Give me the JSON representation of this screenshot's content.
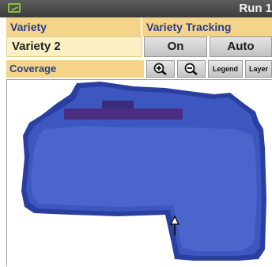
{
  "titlebar": {
    "title": "Run 1",
    "icon": "tractor-monitor-icon"
  },
  "variety": {
    "label": "Variety",
    "value": "Variety 2"
  },
  "tracking": {
    "label": "Variety Tracking",
    "on_label": "On",
    "auto_label": "Auto"
  },
  "coverage": {
    "label": "Coverage",
    "tools": {
      "zoom_in_icon": "zoom-in-icon",
      "zoom_out_icon": "zoom-out-icon",
      "legend_label": "Legend",
      "layer_label": "Layer"
    }
  },
  "map": {
    "colors": {
      "coverage_main": "#3d57c0",
      "coverage_edge": "#2a3fa0",
      "coverage_dark": "#4a2d80",
      "header_bg": "#f4d488",
      "header_text": "#2b3c8c"
    },
    "marker_icon": "arrow-up-icon"
  }
}
